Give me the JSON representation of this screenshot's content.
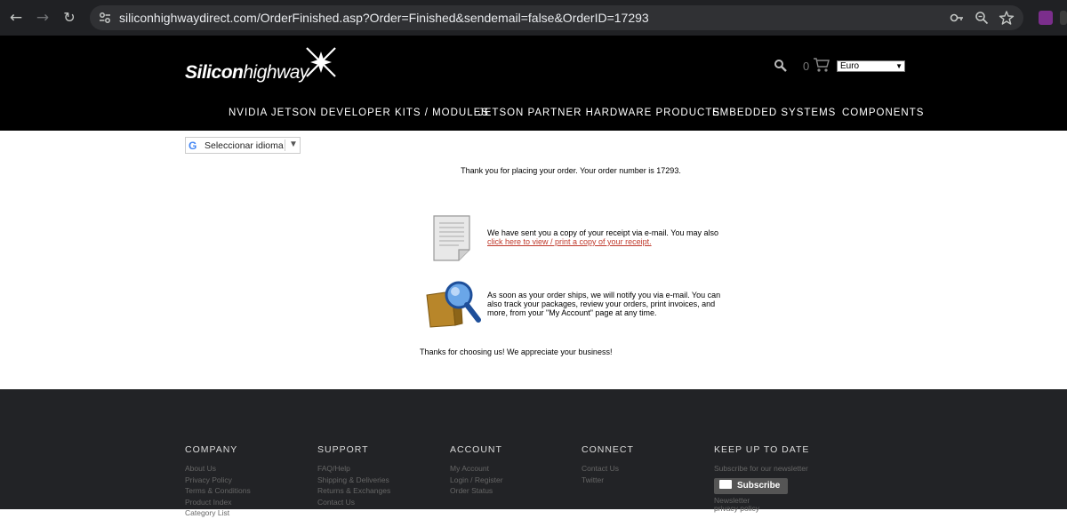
{
  "browser": {
    "url": "siliconhighwaydirect.com/OrderFinished.asp?Order=Finished&sendemail=false&OrderID=17293",
    "back_icon": "←",
    "forward_icon": "→",
    "reload_icon": "↻"
  },
  "header": {
    "logo_bold": "Silicon",
    "logo_regular": "highway",
    "cart_count": "0",
    "currency": "Euro",
    "nav": [
      "NVIDIA JETSON DEVELOPER KITS / MODULES",
      "JETSON PARTNER HARDWARE PRODUCTS",
      "EMBEDDED SYSTEMS",
      "COMPONENTS"
    ]
  },
  "translate": {
    "g": "G",
    "label": "Seleccionar idioma",
    "arrow": "▼"
  },
  "order": {
    "thanks": "Thank you for placing your order. Your order number is 17293.",
    "receipt_text": "We have sent you a copy of your receipt via e-mail. You may also",
    "receipt_link": "click here to view / print a copy of your receipt.",
    "track_text": "As soon as your order ships, we will notify you via e-mail. You can also track your packages, review your orders, print invoices, and more, from your \"My Account\" page at any time.",
    "appreciate": "Thanks for choosing us! We appreciate your business!"
  },
  "footer": {
    "company": {
      "heading": "COMPANY",
      "links": [
        "About Us",
        "Privacy Policy",
        "Terms & Conditions",
        "Product Index",
        "Category List"
      ]
    },
    "support": {
      "heading": "SUPPORT",
      "links": [
        "FAQ/Help",
        "Shipping & Deliveries",
        "Returns & Exchanges",
        "Contact Us"
      ]
    },
    "account": {
      "heading": "ACCOUNT",
      "links": [
        "My Account",
        "Login / Register",
        "Order Status"
      ]
    },
    "connect": {
      "heading": "CONNECT",
      "links": [
        "Contact Us",
        "Twitter"
      ]
    },
    "keep_up": {
      "heading": "KEEP UP TO DATE",
      "subtitle": "Subscribe for our newsletter",
      "subscribe_label": "Subscribe",
      "newsletter_link": "Newsletter",
      "privacy_link": "privacy policy"
    }
  }
}
